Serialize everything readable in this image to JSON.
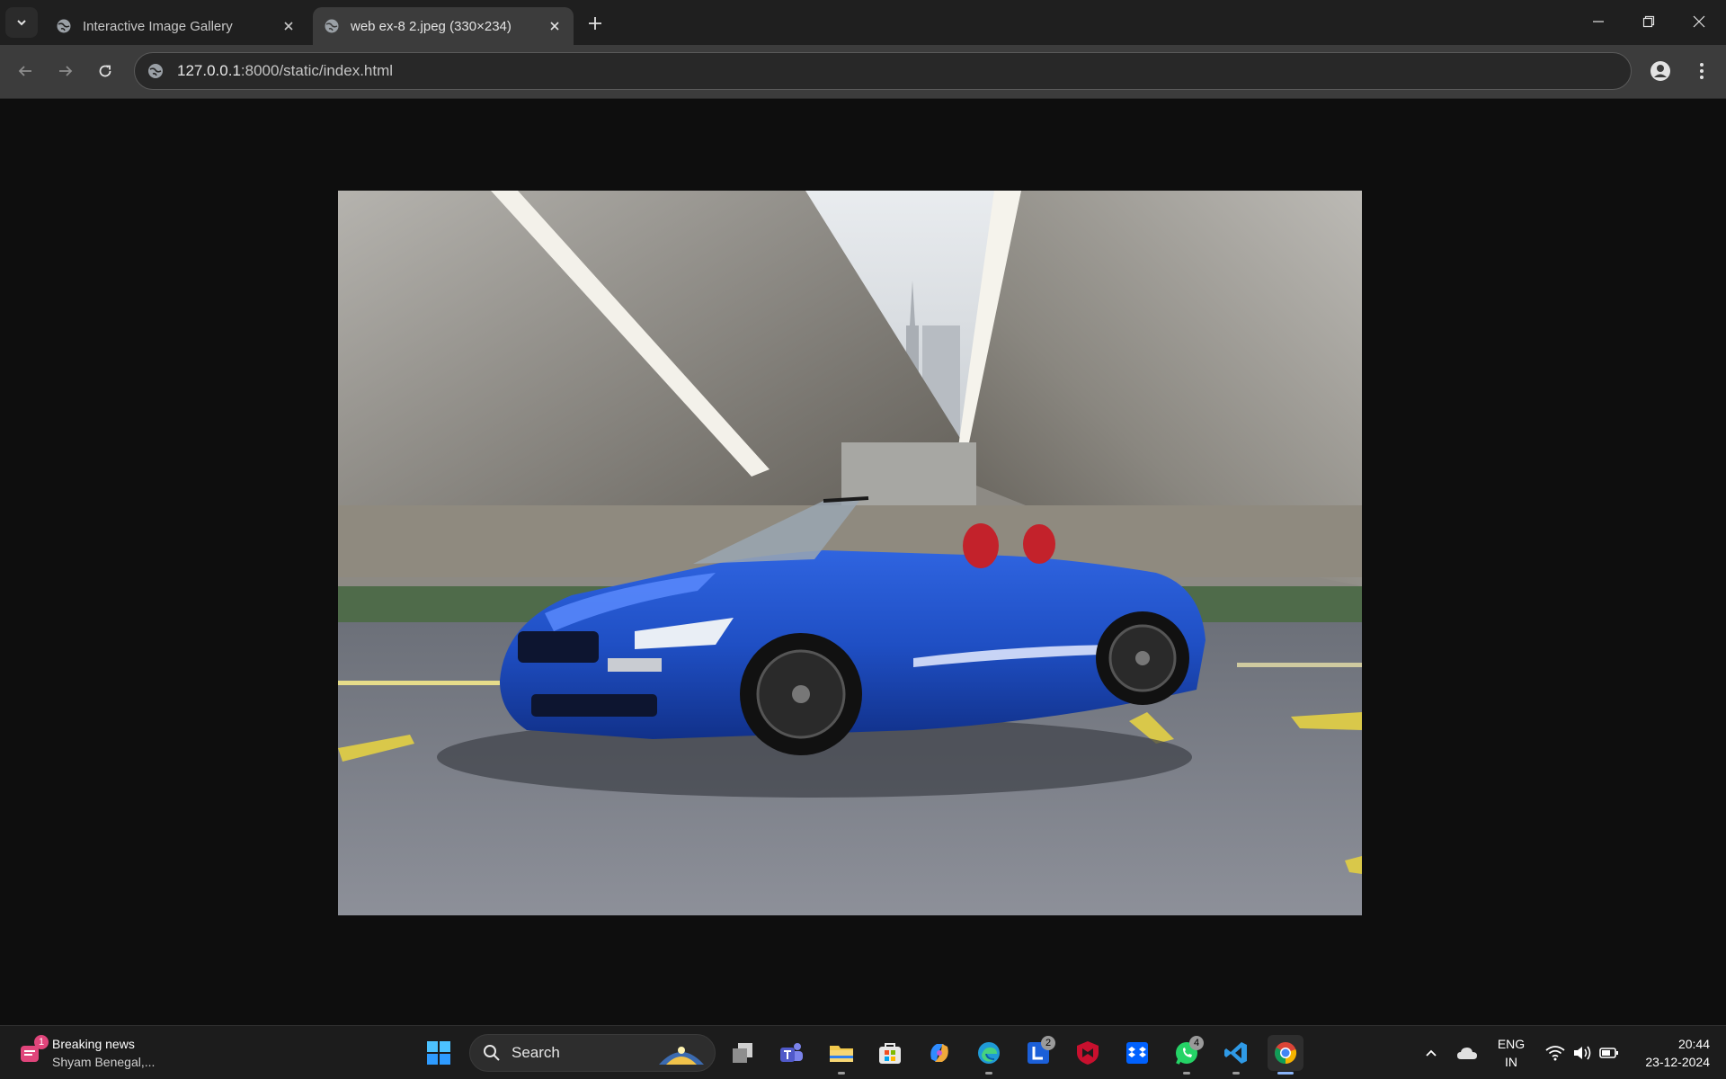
{
  "browser": {
    "tabs": [
      {
        "label": "Interactive Image Gallery",
        "active": false
      },
      {
        "label": "web ex-8 2.jpeg (330×234)",
        "active": true
      }
    ],
    "address": {
      "host": "127.0.0.1",
      "path": ":8000/static/index.html"
    }
  },
  "page": {
    "image": {
      "subject": "blue convertible car under a bridge"
    }
  },
  "taskbar": {
    "news": {
      "title": "Breaking news",
      "subtitle": "Shyam Benegal,...",
      "badge": "1"
    },
    "search_label": "Search",
    "apps": [
      {
        "name": "task-view",
        "badge": ""
      },
      {
        "name": "teams",
        "badge": ""
      },
      {
        "name": "file-explorer",
        "badge": ""
      },
      {
        "name": "microsoft-store",
        "badge": ""
      },
      {
        "name": "copilot",
        "badge": ""
      },
      {
        "name": "edge",
        "badge": ""
      },
      {
        "name": "l-app",
        "badge": "2"
      },
      {
        "name": "mcafee",
        "badge": ""
      },
      {
        "name": "dropbox",
        "badge": ""
      },
      {
        "name": "whatsapp",
        "badge": "4"
      },
      {
        "name": "vscode",
        "badge": ""
      },
      {
        "name": "chrome",
        "badge": ""
      }
    ],
    "tray": {
      "lang_top": "ENG",
      "lang_bottom": "IN",
      "time": "20:44",
      "date": "23-12-2024"
    }
  },
  "colors": {
    "accent": "#8ab4f8",
    "car_blue": "#1f4fc4",
    "page_bg": "#0e0e0e"
  }
}
